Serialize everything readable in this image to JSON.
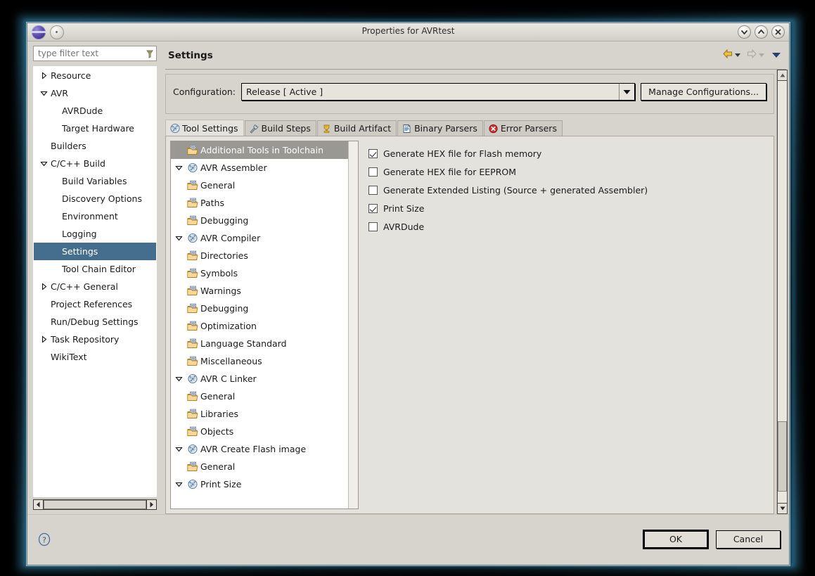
{
  "window": {
    "title": "Properties for AVRtest",
    "controls": [
      {
        "name": "minimize",
        "glyph": "chevron-down"
      },
      {
        "name": "maximize",
        "glyph": "chevron-up"
      },
      {
        "name": "close",
        "glyph": "x"
      }
    ]
  },
  "sidebar": {
    "filter_placeholder": "type filter text",
    "filter_value": "",
    "items": [
      {
        "label": "Resource",
        "depth": 1,
        "arrow": "collapsed",
        "selected": false
      },
      {
        "label": "AVR",
        "depth": 1,
        "arrow": "expanded",
        "selected": false
      },
      {
        "label": "AVRDude",
        "depth": 2,
        "arrow": "none",
        "selected": false
      },
      {
        "label": "Target Hardware",
        "depth": 2,
        "arrow": "none",
        "selected": false
      },
      {
        "label": "Builders",
        "depth": 1,
        "arrow": "none",
        "selected": false
      },
      {
        "label": "C/C++ Build",
        "depth": 1,
        "arrow": "expanded",
        "selected": false
      },
      {
        "label": "Build Variables",
        "depth": 2,
        "arrow": "none",
        "selected": false
      },
      {
        "label": "Discovery Options",
        "depth": 2,
        "arrow": "none",
        "selected": false
      },
      {
        "label": "Environment",
        "depth": 2,
        "arrow": "none",
        "selected": false
      },
      {
        "label": "Logging",
        "depth": 2,
        "arrow": "none",
        "selected": false
      },
      {
        "label": "Settings",
        "depth": 2,
        "arrow": "none",
        "selected": true
      },
      {
        "label": "Tool Chain Editor",
        "depth": 2,
        "arrow": "none",
        "selected": false
      },
      {
        "label": "C/C++ General",
        "depth": 1,
        "arrow": "collapsed",
        "selected": false
      },
      {
        "label": "Project References",
        "depth": 1,
        "arrow": "none",
        "selected": false
      },
      {
        "label": "Run/Debug Settings",
        "depth": 1,
        "arrow": "none",
        "selected": false
      },
      {
        "label": "Task Repository",
        "depth": 1,
        "arrow": "collapsed",
        "selected": false
      },
      {
        "label": "WikiText",
        "depth": 1,
        "arrow": "none",
        "selected": false
      }
    ],
    "selected_color": "#456e8e"
  },
  "page": {
    "title": "Settings",
    "toolbar": [
      {
        "name": "back-arrow",
        "enabled": true
      },
      {
        "name": "forward-arrow",
        "enabled": false
      },
      {
        "name": "view-menu",
        "enabled": true
      }
    ]
  },
  "configuration": {
    "label": "Configuration:",
    "value": "Release  [ Active ]",
    "manage_button": "Manage Configurations..."
  },
  "tabs": [
    {
      "label": "Tool Settings",
      "icon": "tool-settings-icon",
      "active": true
    },
    {
      "label": "Build Steps",
      "icon": "build-steps-icon",
      "active": false
    },
    {
      "label": "Build Artifact",
      "icon": "build-artifact-icon",
      "active": false
    },
    {
      "label": "Binary Parsers",
      "icon": "binary-parsers-icon",
      "active": false
    },
    {
      "label": "Error Parsers",
      "icon": "error-parsers-icon",
      "active": false
    }
  ],
  "tool_tree": {
    "selected_color": "#9a9892",
    "items": [
      {
        "label": "Additional Tools in Toolchain",
        "level": 2,
        "arrow": "none",
        "icon": "folder-icon",
        "selected": true
      },
      {
        "label": "AVR Assembler",
        "level": 1,
        "arrow": "expanded",
        "icon": "toolchain-icon",
        "selected": false
      },
      {
        "label": "General",
        "level": 2,
        "arrow": "none",
        "icon": "folder-icon",
        "selected": false
      },
      {
        "label": "Paths",
        "level": 2,
        "arrow": "none",
        "icon": "folder-icon",
        "selected": false
      },
      {
        "label": "Debugging",
        "level": 2,
        "arrow": "none",
        "icon": "folder-icon",
        "selected": false
      },
      {
        "label": "AVR Compiler",
        "level": 1,
        "arrow": "expanded",
        "icon": "toolchain-icon",
        "selected": false
      },
      {
        "label": "Directories",
        "level": 2,
        "arrow": "none",
        "icon": "folder-icon",
        "selected": false
      },
      {
        "label": "Symbols",
        "level": 2,
        "arrow": "none",
        "icon": "folder-icon",
        "selected": false
      },
      {
        "label": "Warnings",
        "level": 2,
        "arrow": "none",
        "icon": "folder-icon",
        "selected": false
      },
      {
        "label": "Debugging",
        "level": 2,
        "arrow": "none",
        "icon": "folder-icon",
        "selected": false
      },
      {
        "label": "Optimization",
        "level": 2,
        "arrow": "none",
        "icon": "folder-icon",
        "selected": false
      },
      {
        "label": "Language Standard",
        "level": 2,
        "arrow": "none",
        "icon": "folder-icon",
        "selected": false
      },
      {
        "label": "Miscellaneous",
        "level": 2,
        "arrow": "none",
        "icon": "folder-icon",
        "selected": false
      },
      {
        "label": "AVR C Linker",
        "level": 1,
        "arrow": "expanded",
        "icon": "toolchain-icon",
        "selected": false
      },
      {
        "label": "General",
        "level": 2,
        "arrow": "none",
        "icon": "folder-icon",
        "selected": false
      },
      {
        "label": "Libraries",
        "level": 2,
        "arrow": "none",
        "icon": "folder-icon",
        "selected": false
      },
      {
        "label": "Objects",
        "level": 2,
        "arrow": "none",
        "icon": "folder-icon",
        "selected": false
      },
      {
        "label": "AVR Create Flash image",
        "level": 1,
        "arrow": "expanded",
        "icon": "toolchain-icon",
        "selected": false
      },
      {
        "label": "General",
        "level": 2,
        "arrow": "none",
        "icon": "folder-icon",
        "selected": false
      },
      {
        "label": "Print Size",
        "level": 1,
        "arrow": "expanded",
        "icon": "toolchain-icon",
        "selected": false
      }
    ]
  },
  "options": [
    {
      "label": "Generate HEX file for Flash memory",
      "checked": true
    },
    {
      "label": "Generate HEX file for EEPROM",
      "checked": false
    },
    {
      "label": "Generate Extended Listing (Source + generated Assembler)",
      "checked": false
    },
    {
      "label": "Print Size",
      "checked": true
    },
    {
      "label": "AVRDude",
      "checked": false
    }
  ],
  "footer": {
    "help_icon": "help-icon",
    "ok_label": "OK",
    "cancel_label": "Cancel"
  }
}
